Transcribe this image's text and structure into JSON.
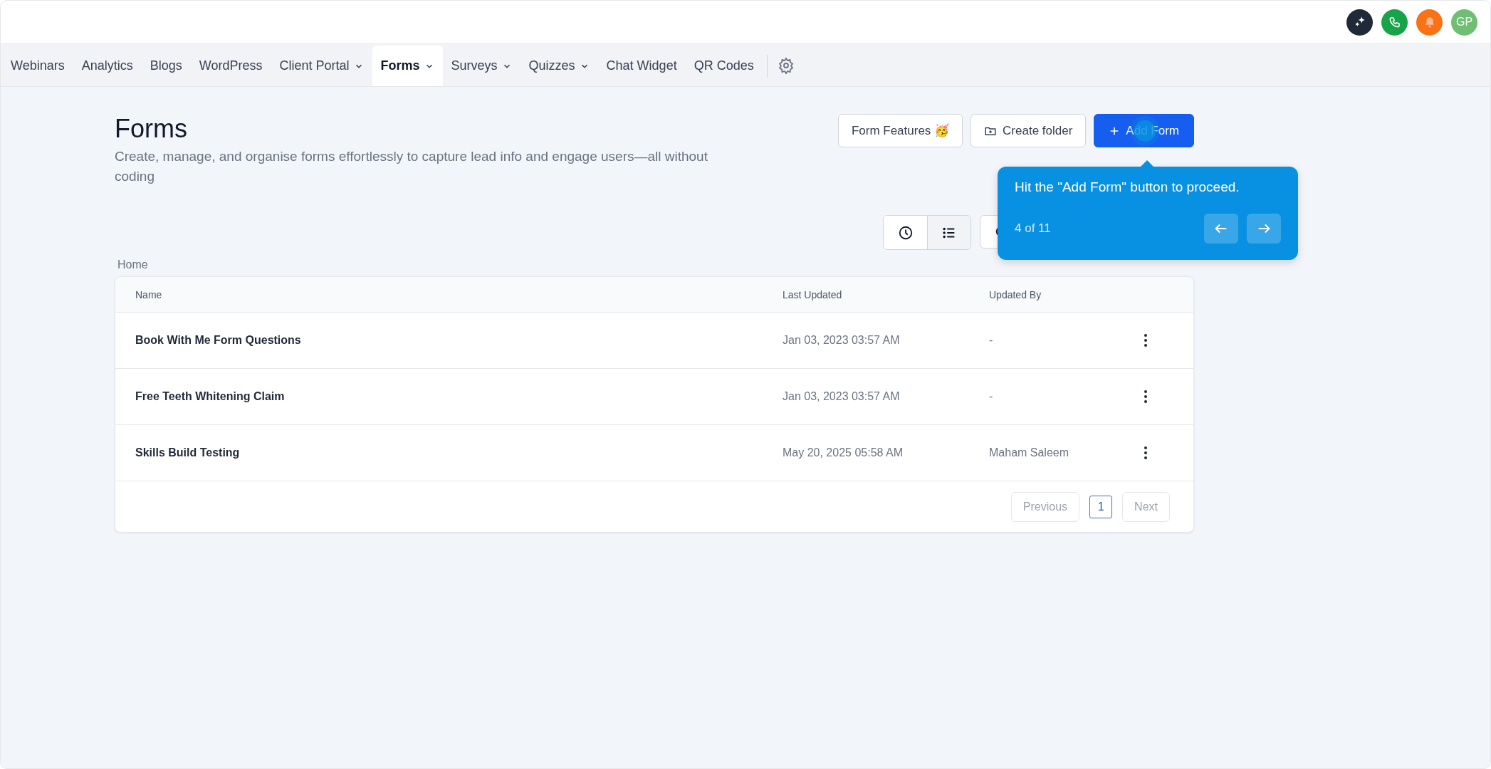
{
  "header_icons": [
    {
      "kind": "sparkle",
      "color": "#1f2937"
    },
    {
      "kind": "phone",
      "color": "#16a34a"
    },
    {
      "kind": "bell",
      "color": "#f97316"
    },
    {
      "kind": "avatar",
      "color": "#6fbf73",
      "initials": "GP"
    }
  ],
  "nav": [
    {
      "label": "Webinars",
      "selected": false,
      "dropdown": false
    },
    {
      "label": "Analytics",
      "selected": false,
      "dropdown": false
    },
    {
      "label": "Blogs",
      "selected": false,
      "dropdown": false
    },
    {
      "label": "WordPress",
      "selected": false,
      "dropdown": false
    },
    {
      "label": "Client Portal",
      "selected": false,
      "dropdown": true
    },
    {
      "label": "Forms",
      "selected": true,
      "dropdown": true
    },
    {
      "label": "Surveys",
      "selected": false,
      "dropdown": true
    },
    {
      "label": "Quizzes",
      "selected": false,
      "dropdown": true
    },
    {
      "label": "Chat Widget",
      "selected": false,
      "dropdown": false
    },
    {
      "label": "QR Codes",
      "selected": false,
      "dropdown": false
    }
  ],
  "page": {
    "title": "Forms",
    "description": "Create, manage, and organise forms effortlessly to capture lead info and engage users—all without coding"
  },
  "actions": [
    {
      "kind": "secondary",
      "label": "Form Features 🥳"
    },
    {
      "kind": "folder",
      "label": "Create folder"
    },
    {
      "kind": "primary",
      "label": "Add Form"
    }
  ],
  "view_toggle": [
    {
      "kind": "recent",
      "selected": false
    },
    {
      "kind": "list",
      "selected": true
    }
  ],
  "breadcrumb": "Home",
  "table": {
    "columns": [
      "Name",
      "Last Updated",
      "Updated By"
    ],
    "rows": [
      {
        "name": "Book With Me Form Questions",
        "last_updated": "Jan 03, 2023 03:57 AM",
        "updated_by": "-"
      },
      {
        "name": "Free Teeth Whitening Claim",
        "last_updated": "Jan 03, 2023 03:57 AM",
        "updated_by": "-"
      },
      {
        "name": "Skills Build Testing",
        "last_updated": "May 20, 2025 05:58 AM",
        "updated_by": "Maham Saleem"
      }
    ]
  },
  "pagination": {
    "previous": "Previous",
    "pages": [
      {
        "label": "1",
        "selected": true
      }
    ],
    "next": "Next"
  },
  "tour": {
    "message": "Hit the \"Add Form\" button to proceed.",
    "step": "4 of 11"
  }
}
